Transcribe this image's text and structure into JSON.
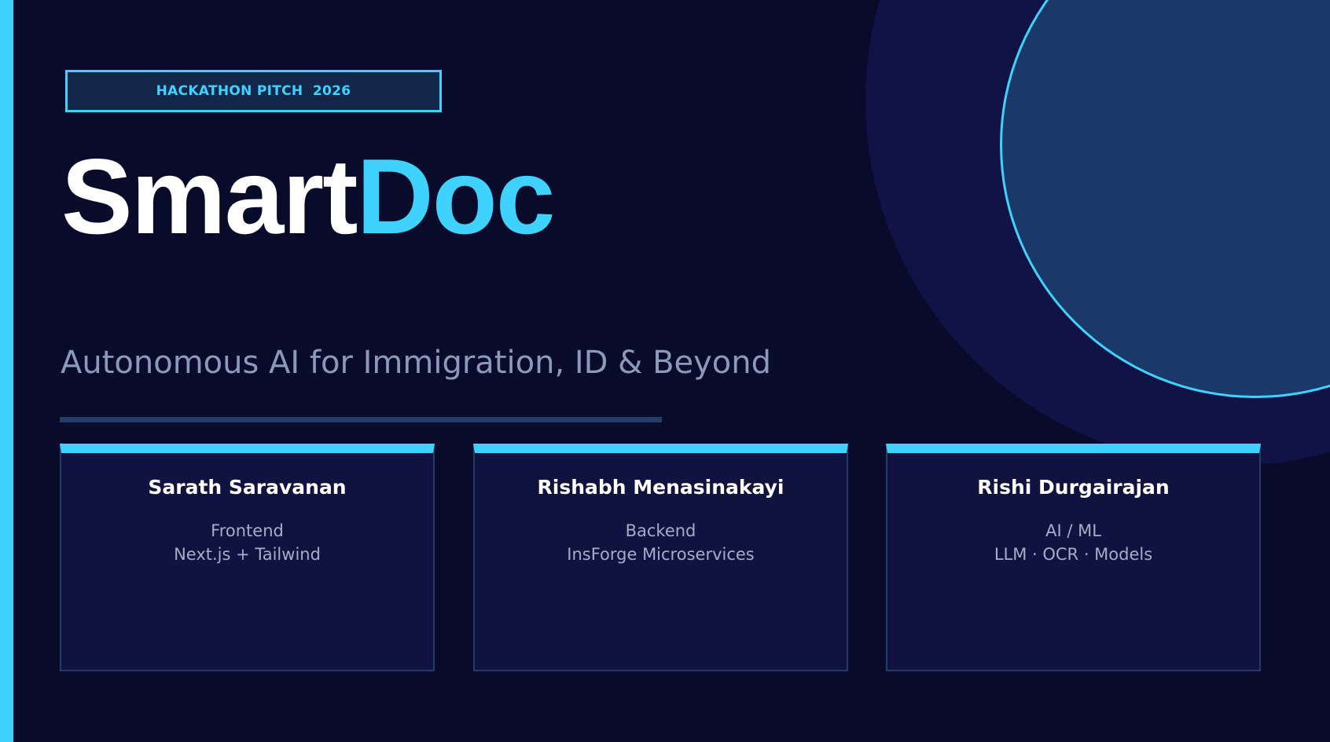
{
  "badge": {
    "text": "HACKATHON PITCH  2026"
  },
  "title": {
    "part1": "Smart",
    "part2": "Doc"
  },
  "subtitle": "Autonomous AI for Immigration, ID & Beyond",
  "colors": {
    "background": "#090b2b",
    "accent": "#3fd2ff",
    "card_bg": "#10123f",
    "circle_outer": "#111246",
    "circle_inner": "#1b3968",
    "subtitle_text": "#8d99b9",
    "divider": "#243d68"
  },
  "team": [
    {
      "name": "Sarath Saravanan",
      "role": "Frontend",
      "stack": "Next.js + Tailwind"
    },
    {
      "name": "Rishabh Menasinakayi",
      "role": "Backend",
      "stack": "InsForge Microservices"
    },
    {
      "name": "Rishi Durgairajan",
      "role": "AI / ML",
      "stack": "LLM · OCR · Models"
    }
  ]
}
